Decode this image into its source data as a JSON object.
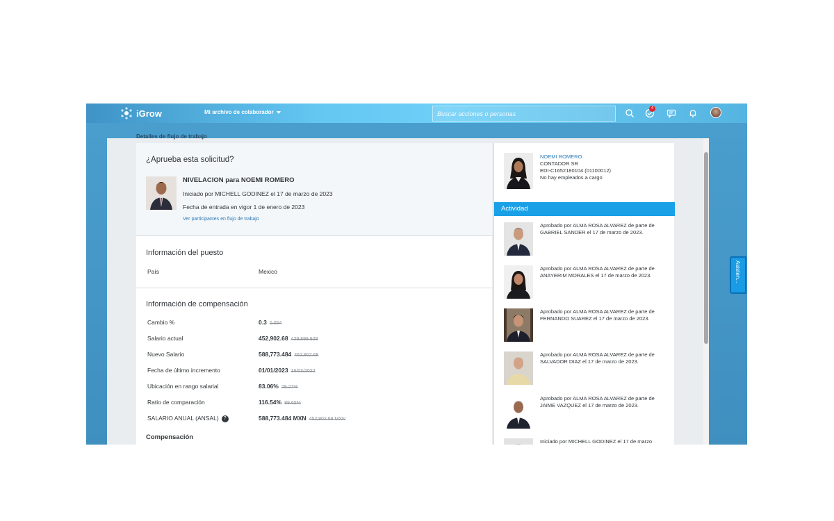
{
  "shell": {
    "app_name": "iGrow",
    "menu_label": "Mi archivo de colaborador",
    "search_placeholder": "Buscar acciones o personas",
    "notification_count": "4"
  },
  "workflow": {
    "section_title": "Detalles de flujo de trabajo",
    "question": "¿Aprueba esta solicitud?",
    "request_title": "NIVELACION para NOEMI ROMERO",
    "initiated": "Iniciado por MICHELL GODINEZ el 17 de marzo de 2023",
    "effective_date": "Fecha de entrada en vigor   1 de enero de 2023",
    "participants_link": "Ver participantes en flujo de trabajo"
  },
  "job_info": {
    "title": "Información del puesto",
    "rows": [
      {
        "label": "País",
        "value": "Mexico"
      }
    ]
  },
  "compensation_info": {
    "title": "Información de compensación",
    "rows": [
      {
        "label": "Cambio %",
        "value": "0.3",
        "old": "0.054"
      },
      {
        "label": "Salario actual",
        "value": "452,902.68",
        "old": "429,898.928"
      },
      {
        "label": "Nuevo Salario",
        "value": "588,773.484",
        "old": "452,902.68"
      },
      {
        "label": "Fecha de último incremento",
        "value": "01/01/2023",
        "old": "16/03/2022"
      },
      {
        "label": "Ubicación en rango salarial",
        "value": "83.06%",
        "old": "29.27%"
      },
      {
        "label": "Ratio de comparación",
        "value": "116.54%",
        "old": "89.65%"
      },
      {
        "label": "SALARIO ANUAL (ANSAL)",
        "value": "588,773.484 MXN",
        "old": "452,902.68 MXN"
      }
    ],
    "subsection": "Compensación"
  },
  "employee": {
    "name": "NOEMI ROMERO",
    "position": "CONTADOR SR",
    "id": "EDI-C1652180104 (01100012)",
    "reports": "No hay empleados a cargo"
  },
  "activity": {
    "title": "Actividad",
    "items": [
      {
        "text": "Aprobado por ALMA ROSA ALVAREZ de parte de GABRIEL SANDER el 17 de marzo de 2023."
      },
      {
        "text": "Aprobado por ALMA ROSA ALVAREZ de parte de ANAYERIM MORALES el 17 de marzo de 2023."
      },
      {
        "text": "Aprobado por ALMA ROSA ALVAREZ de parte de FERNANDO SUAREZ el 17 de marzo de 2023."
      },
      {
        "text": "Aprobado por ALMA ROSA ALVAREZ de parte de SALVADOR DIAZ el 17 de marzo de 2023."
      },
      {
        "text": "Aprobado por ALMA ROSA ALVAREZ de parte de JAIME VAZQUEZ el 17 de marzo de 2023."
      },
      {
        "text": "Iniciado por MICHELL GODINEZ el 17 de marzo"
      }
    ]
  },
  "assistant": {
    "label": "Asisten..."
  },
  "colors": {
    "shell": "#63c7f2",
    "activity_bar": "#19a0e6",
    "link": "#2b7ab9"
  }
}
